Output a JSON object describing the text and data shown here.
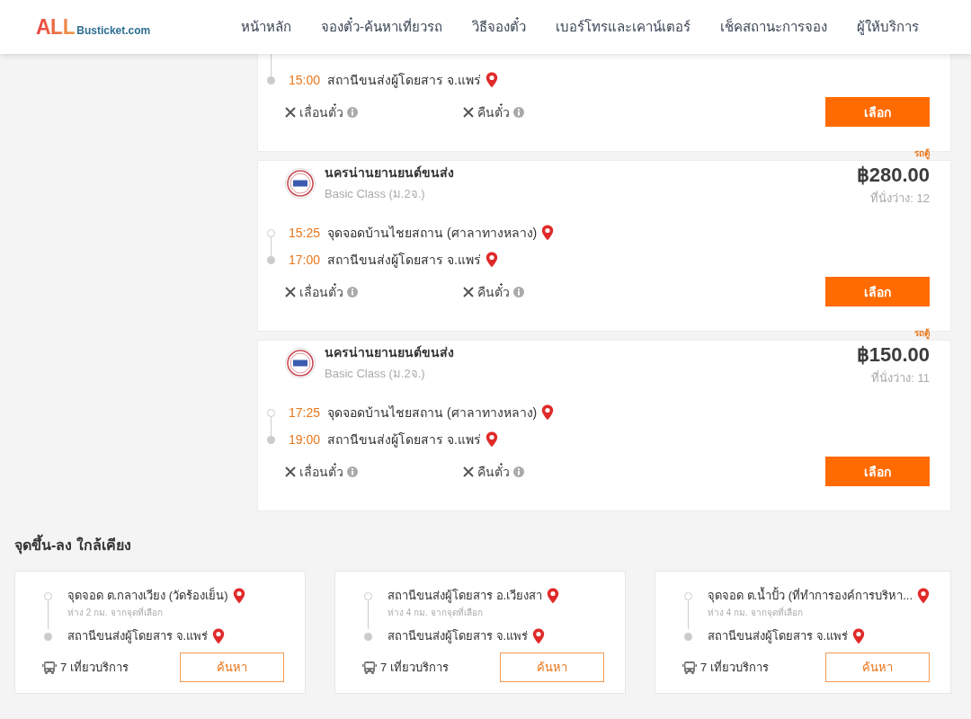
{
  "header": {
    "logo": {
      "brand": "ALL",
      "suffix": "Busticket.com"
    },
    "nav": [
      {
        "label": "หน้าหลัก"
      },
      {
        "label": "จองตั๋ว-ค้นหาเที่ยวรถ"
      },
      {
        "label": "วิธีจองตั๋ว"
      },
      {
        "label": "เบอร์โทรและเคาน์เตอร์"
      },
      {
        "label": "เช็คสถานะการจอง"
      },
      {
        "label": "ผู้ให้บริการ"
      }
    ]
  },
  "trips": [
    {
      "stops": [
        {
          "time": "15:00",
          "place": "สถานีขนส่งผู้โดยสาร จ.แพร่"
        }
      ],
      "actions": [
        {
          "label": "เลื่อนตั๋ว"
        },
        {
          "label": "คืนตั๋ว"
        }
      ],
      "button": "เลือก"
    },
    {
      "vehicle": "รถตู้",
      "operator": "นครน่านยานยนต์ขนส่ง",
      "class": "Basic Class (ม.2จ.)",
      "price": "฿280.00",
      "seats": "ที่นั่งว่าง: 12",
      "stops": [
        {
          "time": "15:25",
          "place": "จุดจอดบ้านไชยสถาน (ศาลาทางหลาง)"
        },
        {
          "time": "17:00",
          "place": "สถานีขนส่งผู้โดยสาร จ.แพร่"
        }
      ],
      "actions": [
        {
          "label": "เลื่อนตั๋ว"
        },
        {
          "label": "คืนตั๋ว"
        }
      ],
      "button": "เลือก"
    },
    {
      "vehicle": "รถตู้",
      "operator": "นครน่านยานยนต์ขนส่ง",
      "class": "Basic Class (ม.2จ.)",
      "price": "฿150.00",
      "seats": "ที่นั่งว่าง: 11",
      "stops": [
        {
          "time": "17:25",
          "place": "จุดจอดบ้านไชยสถาน (ศาลาทางหลาง)"
        },
        {
          "time": "19:00",
          "place": "สถานีขนส่งผู้โดยสาร จ.แพร่"
        }
      ],
      "actions": [
        {
          "label": "เลื่อนตั๋ว"
        },
        {
          "label": "คืนตั๋ว"
        }
      ],
      "button": "เลือก"
    }
  ],
  "nearby": {
    "title": "จุดขึ้น-ลง ใกล้เคียง",
    "cards": [
      {
        "from": "จุดจอด ต.กลางเวียง (วัดร้องเย็น)",
        "distance": "ห่าง 2 กม. จากจุดที่เลือก",
        "to": "สถานีขนส่งผู้โดยสาร จ.แพร่",
        "trips": "7 เที่ยวบริการ",
        "button": "ค้นหา"
      },
      {
        "from": "สถานีขนส่งผู้โดยสาร อ.เวียงสา",
        "distance": "ห่าง 4 กม. จากจุดที่เลือก",
        "to": "สถานีขนส่งผู้โดยสาร จ.แพร่",
        "trips": "7 เที่ยวบริการ",
        "button": "ค้นหา"
      },
      {
        "from": "จุดจอด ต.น้ำปั้ว (ที่ทำการองค์การบริหา...",
        "distance": "ห่าง 4 กม. จากจุดที่เลือก",
        "to": "สถานีขนส่งผู้โดยสาร จ.แพร่",
        "trips": "7 เที่ยวบริการ",
        "button": "ค้นหา"
      }
    ]
  }
}
